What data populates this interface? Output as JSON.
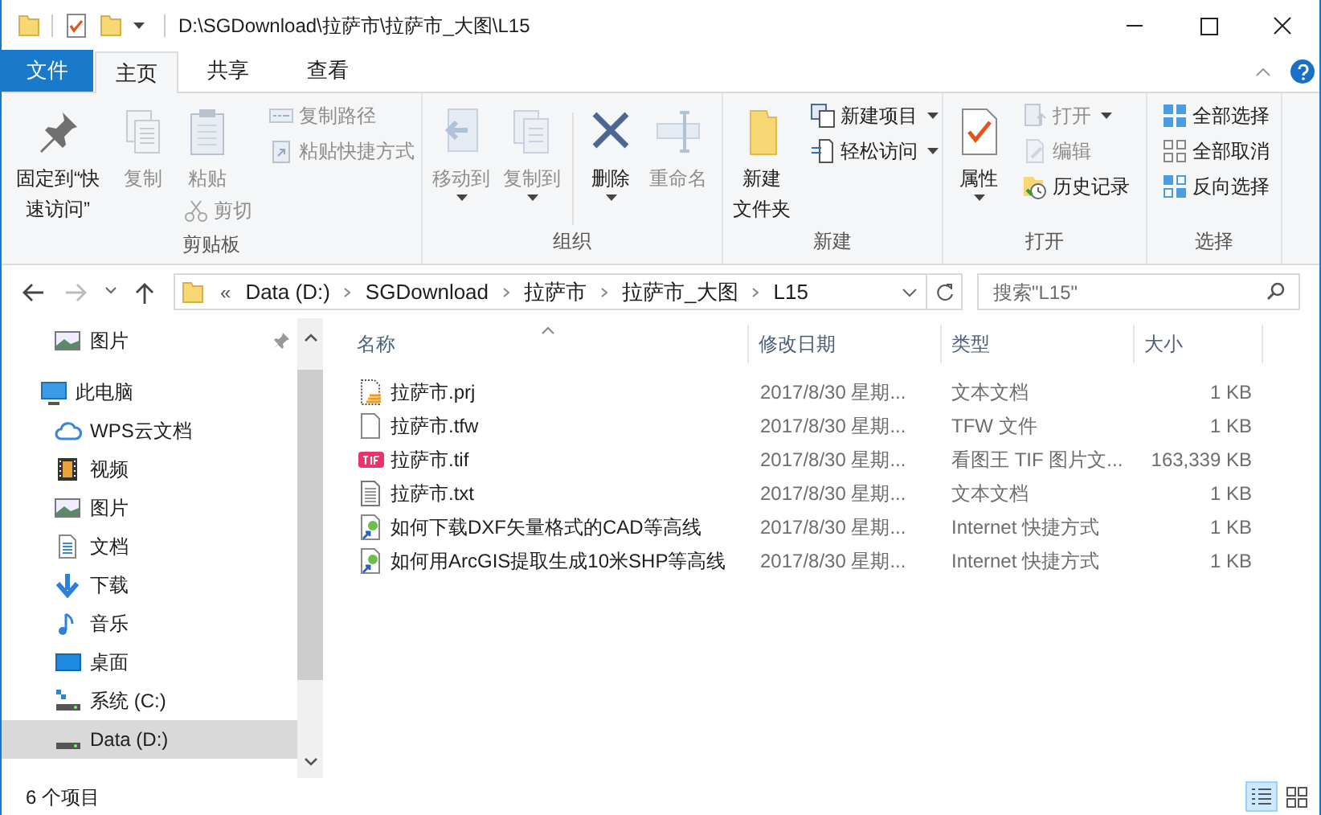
{
  "title_bar": {
    "title": "D:\\SGDownload\\拉萨市\\拉萨市_大图\\L15"
  },
  "tabs": [
    {
      "label": "文件",
      "kind": "file",
      "selected": false
    },
    {
      "label": "主页",
      "kind": "tab",
      "selected": true
    },
    {
      "label": "共享",
      "kind": "tab",
      "selected": false
    },
    {
      "label": "查看",
      "kind": "tab",
      "selected": false
    }
  ],
  "ribbon": {
    "groups": [
      {
        "label": "剪贴板",
        "columns": [
          [
            {
              "label": "固定到“快速访问”",
              "kind": "large",
              "disabled": false,
              "dropdown": false
            }
          ],
          [
            {
              "label": "复制",
              "kind": "large",
              "disabled": true,
              "dropdown": false
            }
          ],
          [
            {
              "label": "粘贴",
              "kind": "large",
              "disabled": true,
              "dropdown": false
            },
            {
              "label": "剪切",
              "kind": "small",
              "disabled": true,
              "dropdown": false
            }
          ],
          [
            {
              "label": "复制路径",
              "kind": "small",
              "disabled": true,
              "dropdown": false
            },
            {
              "label": "粘贴快捷方式",
              "kind": "small",
              "disabled": true,
              "dropdown": false
            }
          ]
        ]
      },
      {
        "label": "组织",
        "columns": [
          [
            {
              "label": "移动到",
              "kind": "large",
              "disabled": true,
              "dropdown": true
            }
          ],
          [
            {
              "label": "复制到",
              "kind": "large",
              "disabled": true,
              "dropdown": true
            }
          ],
          [
            {
              "label": "删除",
              "kind": "large",
              "disabled": false,
              "dropdown": true
            }
          ],
          [
            {
              "label": "重命名",
              "kind": "large",
              "disabled": true,
              "dropdown": false
            }
          ]
        ]
      },
      {
        "label": "新建",
        "columns": [
          [
            {
              "label": "新建文件夹",
              "kind": "large",
              "disabled": false,
              "dropdown": false
            }
          ],
          [
            {
              "label": "新建项目",
              "kind": "small",
              "disabled": false,
              "dropdown": true
            },
            {
              "label": "轻松访问",
              "kind": "small",
              "disabled": false,
              "dropdown": true
            }
          ]
        ]
      },
      {
        "label": "打开",
        "columns": [
          [
            {
              "label": "属性",
              "kind": "large",
              "disabled": false,
              "dropdown": true
            }
          ],
          [
            {
              "label": "打开",
              "kind": "small",
              "disabled": true,
              "dropdown": true
            },
            {
              "label": "编辑",
              "kind": "small",
              "disabled": true,
              "dropdown": false
            },
            {
              "label": "历史记录",
              "kind": "small",
              "disabled": false,
              "dropdown": false
            }
          ]
        ]
      },
      {
        "label": "选择",
        "columns": [
          [
            {
              "label": "全部选择",
              "kind": "small",
              "disabled": false,
              "dropdown": false
            },
            {
              "label": "全部取消",
              "kind": "small",
              "disabled": false,
              "dropdown": false
            },
            {
              "label": "反向选择",
              "kind": "small",
              "disabled": false,
              "dropdown": false
            }
          ]
        ]
      }
    ]
  },
  "address_bar": {
    "crumbs": [
      "Data (D:)",
      "SGDownload",
      "拉萨市",
      "拉萨市_大图",
      "L15"
    ],
    "overflow": "«"
  },
  "search": {
    "placeholder": "搜索\"L15\""
  },
  "navigation": {
    "items": [
      {
        "label": "图片",
        "pinned": true,
        "selected": false
      },
      {
        "label": "此电脑",
        "pinned": false,
        "selected": false,
        "children": [
          {
            "label": "WPS云文档",
            "selected": false
          },
          {
            "label": "视频",
            "selected": false
          },
          {
            "label": "图片",
            "selected": false
          },
          {
            "label": "文档",
            "selected": false
          },
          {
            "label": "下载",
            "selected": false
          },
          {
            "label": "音乐",
            "selected": false
          },
          {
            "label": "桌面",
            "selected": false
          },
          {
            "label": "系统 (C:)",
            "selected": false
          },
          {
            "label": "Data (D:)",
            "selected": true
          }
        ]
      }
    ]
  },
  "file_list": {
    "columns": [
      {
        "label": "名称",
        "sorted": true
      },
      {
        "label": "修改日期",
        "sorted": false
      },
      {
        "label": "类型",
        "sorted": false
      },
      {
        "label": "大小",
        "sorted": false
      }
    ],
    "rows": [
      {
        "name": "拉萨市.prj",
        "date": "2017/8/30 星期...",
        "type": "文本文档",
        "size": "1 KB",
        "selected": false
      },
      {
        "name": "拉萨市.tfw",
        "date": "2017/8/30 星期...",
        "type": "TFW 文件",
        "size": "1 KB",
        "selected": false
      },
      {
        "name": "拉萨市.tif",
        "date": "2017/8/30 星期...",
        "type": "看图王 TIF 图片文...",
        "size": "163,339 KB",
        "selected": false
      },
      {
        "name": "拉萨市.txt",
        "date": "2017/8/30 星期...",
        "type": "文本文档",
        "size": "1 KB",
        "selected": false
      },
      {
        "name": "如何下载DXF矢量格式的CAD等高线",
        "date": "2017/8/30 星期...",
        "type": "Internet 快捷方式",
        "size": "1 KB",
        "selected": false
      },
      {
        "name": "如何用ArcGIS提取生成10米SHP等高线",
        "date": "2017/8/30 星期...",
        "type": "Internet 快捷方式",
        "size": "1 KB",
        "selected": false
      }
    ]
  },
  "status_bar": {
    "text": "6 个项目",
    "views": [
      {
        "selected": true
      },
      {
        "selected": false
      }
    ]
  }
}
